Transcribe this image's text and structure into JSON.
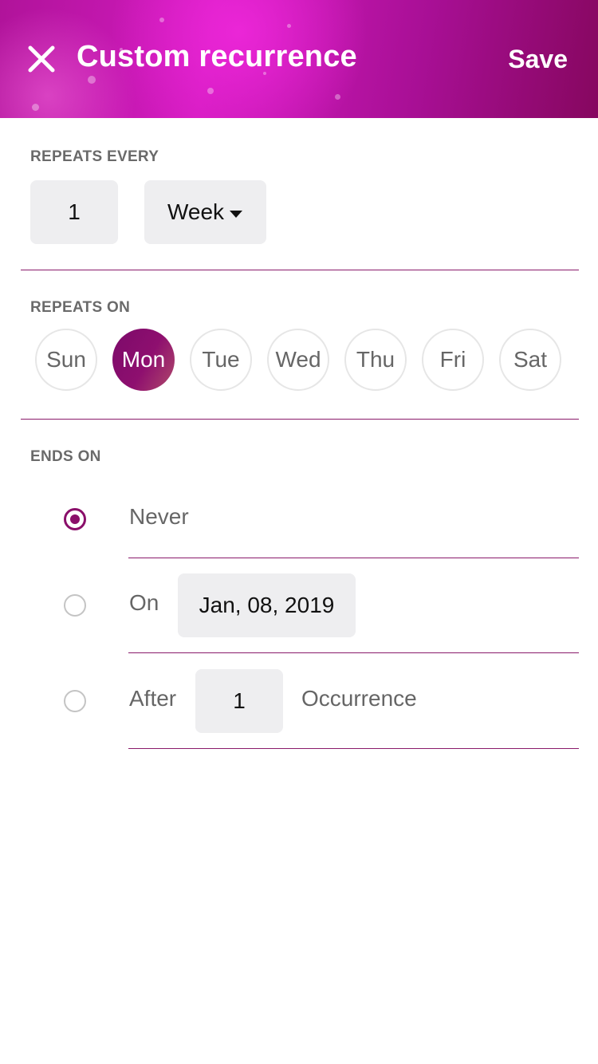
{
  "header": {
    "title": "Custom recurrence",
    "save_label": "Save",
    "close_icon": "close-icon",
    "gradient_colors": [
      "#b0139a",
      "#d31bc0",
      "#86075f"
    ]
  },
  "repeats_every": {
    "label": "REPEATS EVERY",
    "interval_value": "1",
    "unit_value": "Week",
    "unit_icon": "caret-down-icon"
  },
  "repeats_on": {
    "label": "REPEATS ON",
    "days": [
      {
        "label": "Sun",
        "selected": false
      },
      {
        "label": "Mon",
        "selected": true
      },
      {
        "label": "Tue",
        "selected": false
      },
      {
        "label": "Wed",
        "selected": false
      },
      {
        "label": "Thu",
        "selected": false
      },
      {
        "label": "Fri",
        "selected": false
      },
      {
        "label": "Sat",
        "selected": false
      }
    ]
  },
  "ends_on": {
    "label": "ENDS ON",
    "never_label": "Never",
    "on_label": "On",
    "on_date": "Jan, 08, 2019",
    "after_label": "After",
    "after_count": "1",
    "occurrence_label": "Occurrence",
    "selected_option": "never"
  },
  "colors": {
    "accent": "#8a0f6a",
    "input_bg": "#eeeef0"
  }
}
